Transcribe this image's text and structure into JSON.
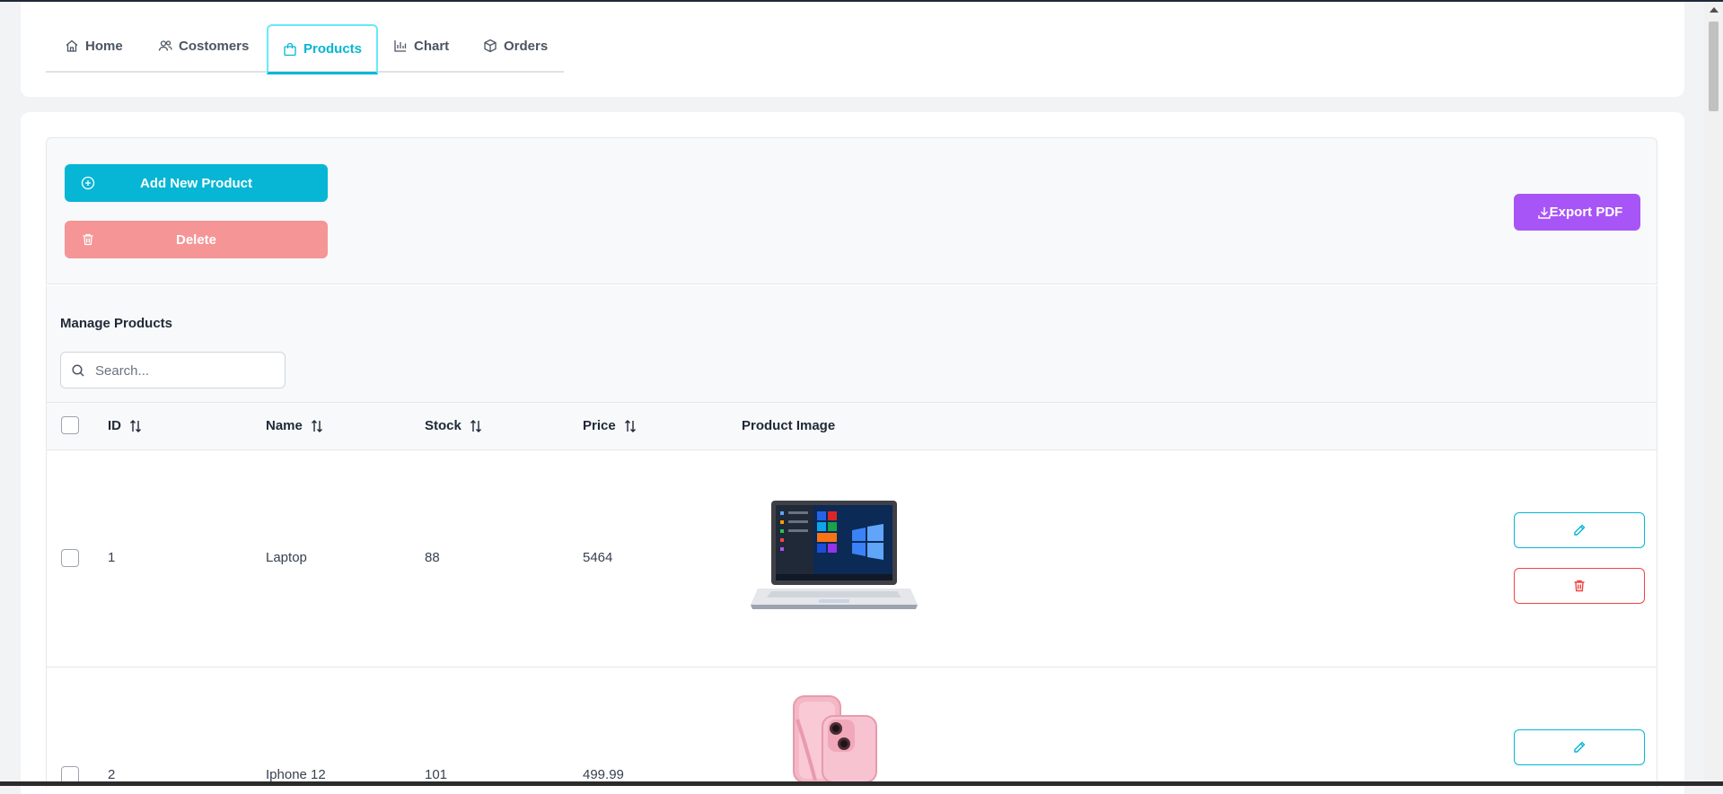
{
  "nav": {
    "tabs": [
      {
        "label": "Home",
        "icon": "home-icon"
      },
      {
        "label": "Costomers",
        "icon": "users-icon"
      },
      {
        "label": "Products",
        "icon": "shopping-bag-icon",
        "active": true
      },
      {
        "label": "Chart",
        "icon": "bar-chart-icon"
      },
      {
        "label": "Orders",
        "icon": "box-icon"
      }
    ]
  },
  "toolbar": {
    "add_label": "Add New Product",
    "delete_label": "Delete",
    "export_label": "Export PDF"
  },
  "table": {
    "title": "Manage Products",
    "search_placeholder": "Search...",
    "columns": [
      "ID",
      "Name",
      "Stock",
      "Price",
      "Product Image"
    ],
    "rows": [
      {
        "id": "1",
        "name": "Laptop",
        "stock": "88",
        "price": "5464",
        "image": "laptop-image"
      },
      {
        "id": "2",
        "name": "Iphone 12",
        "stock": "101",
        "price": "499.99",
        "image": "pink-iphone-image"
      }
    ]
  },
  "colors": {
    "primary": "#06b6d4",
    "danger": "#ef4444",
    "delete_button": "#f59595",
    "export_button": "#a855f7"
  }
}
